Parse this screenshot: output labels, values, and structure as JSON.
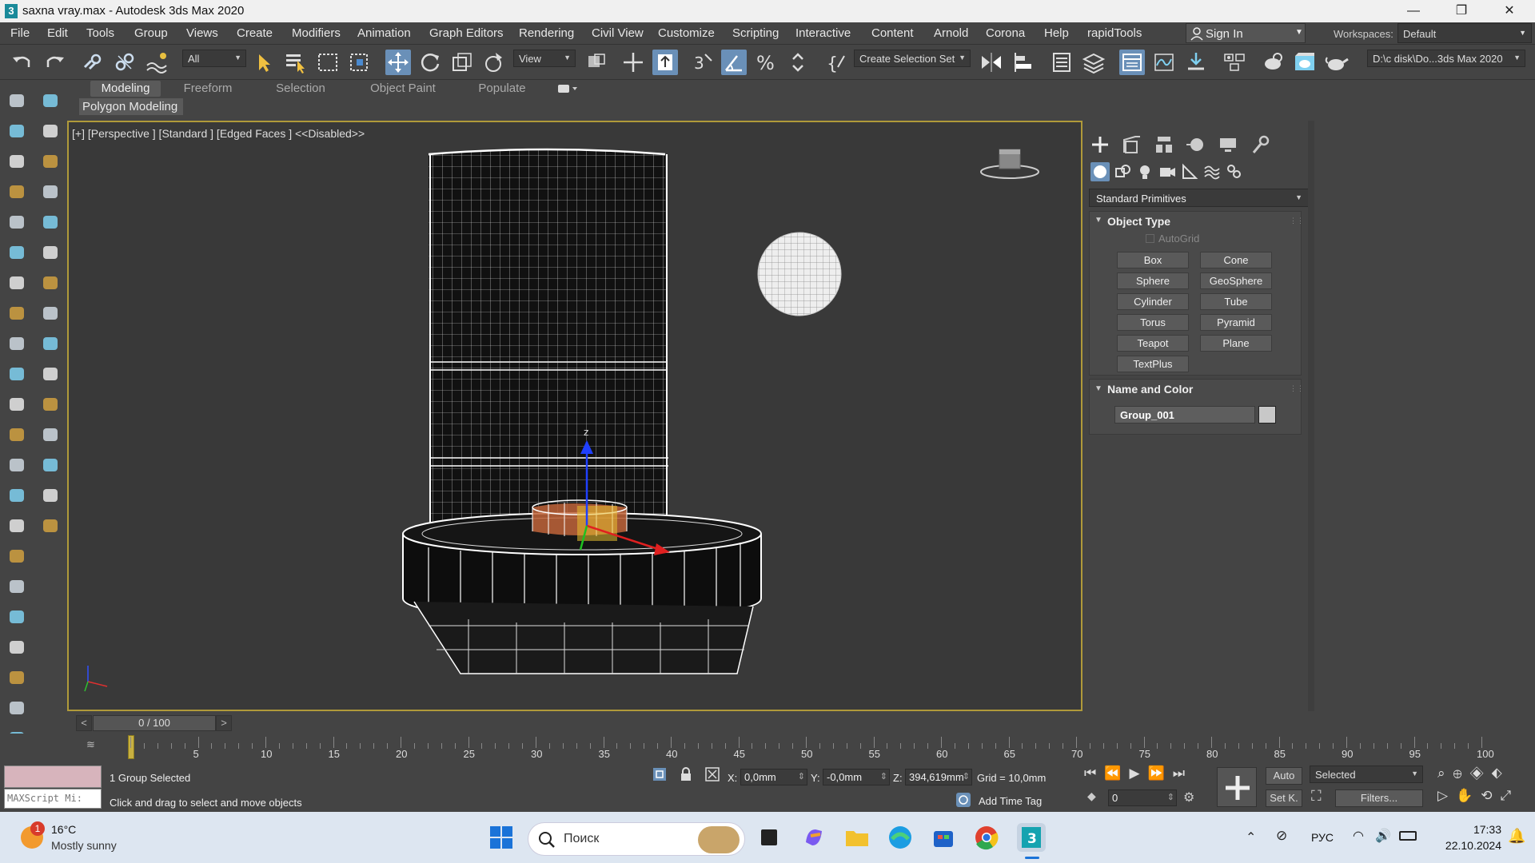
{
  "window": {
    "title": "saxna vray.max - Autodesk 3ds Max 2020",
    "minimize": "—",
    "maximize": "❐",
    "close": "✕"
  },
  "menu": [
    "File",
    "Edit",
    "Tools",
    "Group",
    "Views",
    "Create",
    "Modifiers",
    "Animation",
    "Graph Editors",
    "Rendering",
    "Civil View",
    "Customize",
    "Scripting",
    "Interactive",
    "Content",
    "Arnold",
    "Corona",
    "Help",
    "rapidTools"
  ],
  "signin": {
    "label": "Sign In"
  },
  "workspace": {
    "label": "Workspaces:",
    "value": "Default"
  },
  "toolbar": {
    "filter_value": "All",
    "refcoord_value": "View",
    "selection_set": "Create Selection Set",
    "project_path": "D:\\c disk\\Do...3ds Max 2020"
  },
  "ribbon": {
    "tabs": [
      "Modeling",
      "Freeform",
      "Selection",
      "Object Paint",
      "Populate"
    ],
    "active_tab": "Modeling",
    "panel": "Polygon Modeling"
  },
  "viewport": {
    "label": "[+] [Perspective ] [Standard ] [Edged Faces ]  <<Disabled>>",
    "gizmo_z": "z"
  },
  "command_panel": {
    "category": "Standard Primitives",
    "object_type": {
      "title": "Object Type",
      "autogrid": "AutoGrid",
      "buttons": [
        "Box",
        "Cone",
        "Sphere",
        "GeoSphere",
        "Cylinder",
        "Tube",
        "Torus",
        "Pyramid",
        "Teapot",
        "Plane",
        "TextPlus"
      ]
    },
    "name_and_color": {
      "title": "Name and Color",
      "name": "Group_001",
      "color": "#c8c8c8"
    }
  },
  "time": {
    "slider": "0 / 100",
    "prev": "<",
    "next": ">",
    "ticks": [
      "5",
      "10",
      "15",
      "20",
      "25",
      "30",
      "35",
      "40",
      "45",
      "50",
      "55",
      "60",
      "65",
      "70",
      "75",
      "80",
      "85",
      "90",
      "95",
      "100"
    ]
  },
  "status": {
    "maxscript": "MAXScript Mi:",
    "selection": "1 Group Selected",
    "prompt": "Click and drag to select and move objects",
    "x_label": "X:",
    "x": "0,0mm",
    "y_label": "Y:",
    "y": "-0,0mm",
    "z_label": "Z:",
    "z": "394,619mm",
    "grid": "Grid = 10,0mm",
    "add_time_tag": "Add Time Tag",
    "auto": "Auto",
    "setk": "Set K.",
    "key_filter": "Selected",
    "filters": "Filters...",
    "frame": "0"
  },
  "taskbar": {
    "temp": "16°C",
    "weather": "Mostly sunny",
    "badge": "1",
    "search_placeholder": "Поиск",
    "lang": "РУС",
    "time": "17:33",
    "date": "22.10.2024"
  },
  "colors": {
    "accent": "#6a90b8",
    "viewport_border": "#b09a3a",
    "maxscript_bg": "#d7b4bc"
  }
}
